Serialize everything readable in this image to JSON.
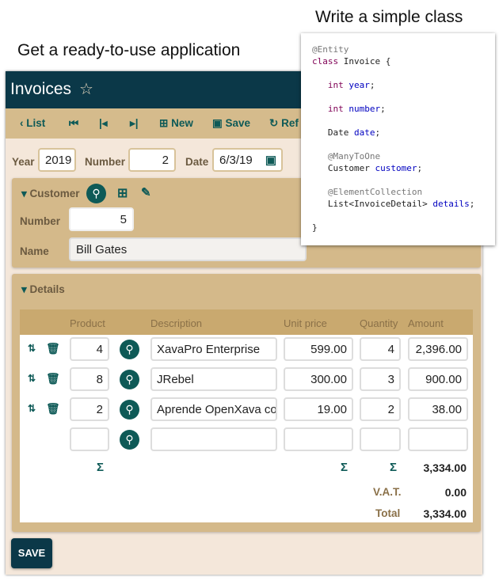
{
  "captions": {
    "left": "Get a ready-to-use application",
    "right": "Write a simple class"
  },
  "header": {
    "title": "Invoices"
  },
  "toolbar": {
    "list": "List",
    "new": "New",
    "save": "Save",
    "refresh": "Ref"
  },
  "form": {
    "year_label": "Year",
    "year": "2019",
    "number_label": "Number",
    "number": "2",
    "date_label": "Date",
    "date": "6/3/19"
  },
  "customer": {
    "title": "Customer",
    "number_label": "Number",
    "number": "5",
    "name_label": "Name",
    "name": "Bill Gates"
  },
  "details": {
    "title": "Details",
    "columns": [
      "Product",
      "Description",
      "Unit price",
      "Quantity",
      "Amount"
    ],
    "rows": [
      {
        "product": "4",
        "description": "XavaPro Enterprise",
        "unit_price": "599.00",
        "quantity": "4",
        "amount": "2,396.00"
      },
      {
        "product": "8",
        "description": "JRebel",
        "unit_price": "300.00",
        "quantity": "3",
        "amount": "900.00"
      },
      {
        "product": "2",
        "description": "Aprende OpenXava con",
        "unit_price": "19.00",
        "quantity": "2",
        "amount": "38.00"
      }
    ],
    "sum_symbol": "Σ",
    "sum": "3,334.00",
    "vat_label": "V.A.T.",
    "vat": "0.00",
    "total_label": "Total",
    "total": "3,334.00"
  },
  "save_button": "SAVE",
  "code": {
    "l1": "@Entity",
    "l2a": "class",
    "l2b": " Invoice {",
    "l3a": "int",
    "l3b": "year",
    "l4a": "int",
    "l4b": "number",
    "l5a": "Date ",
    "l5b": "date",
    "l6": "@ManyToOne",
    "l7a": "Customer ",
    "l7b": "customer",
    "l8": "@ElementCollection",
    "l9a": "List<InvoiceDetail> ",
    "l9b": "details",
    "l10": "}"
  }
}
